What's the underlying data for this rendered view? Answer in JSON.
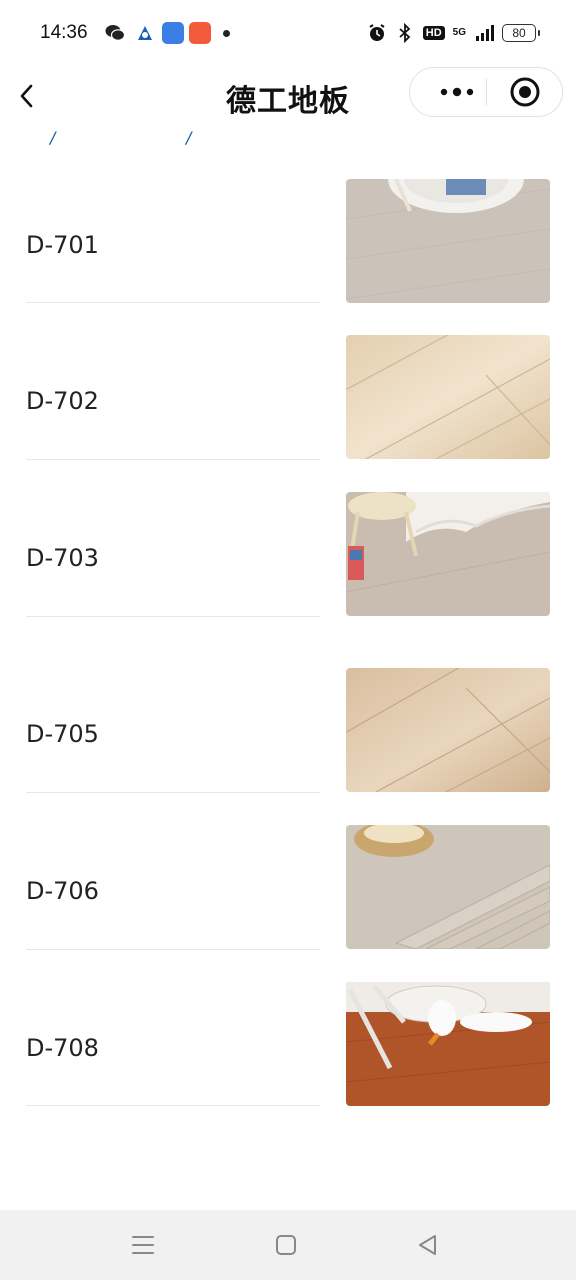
{
  "status_bar": {
    "time": "14:36",
    "battery": "80",
    "network": "5G",
    "hd_badge": "HD"
  },
  "nav": {
    "title": "德工地板",
    "crumbs": [
      "/",
      "/"
    ]
  },
  "products": [
    {
      "name": "D-701",
      "image": "grey oak floor with round rug"
    },
    {
      "name": "D-702",
      "image": "light natural wood planks"
    },
    {
      "name": "D-703",
      "image": "grey floor with stool and curtain"
    },
    {
      "name": "D-705",
      "image": "light wood planks"
    },
    {
      "name": "D-706",
      "image": "grey planks stack with basket"
    },
    {
      "name": "D-708",
      "image": "walnut floor with stool and plush goose"
    }
  ],
  "colors": {
    "accent": "#1b5fa8",
    "divider": "#e6e6e6",
    "system_nav_bg": "#f1f1f1"
  }
}
